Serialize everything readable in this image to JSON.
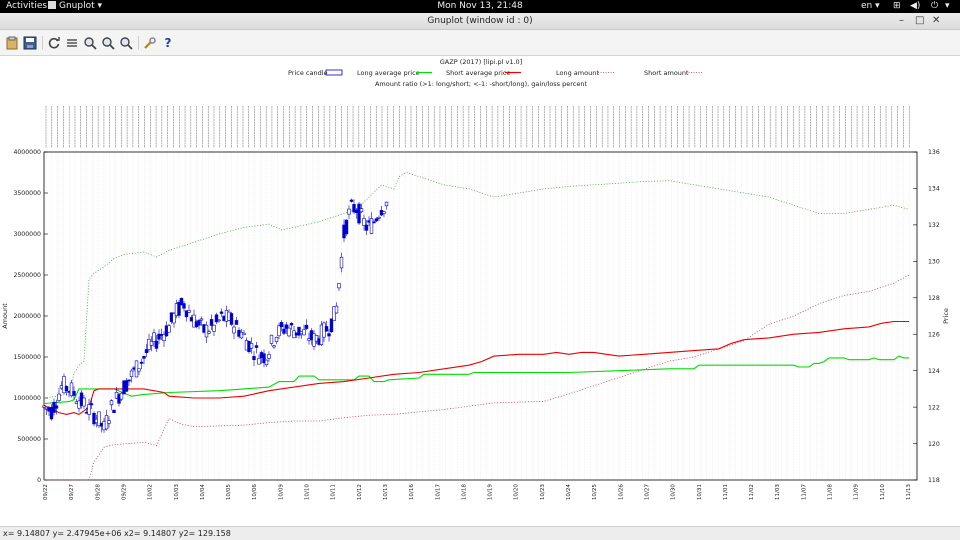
{
  "topbar": {
    "activities": "Activities",
    "app_name": "Gnuplot",
    "clock": "Mon Nov 13, 21:48",
    "language": "en"
  },
  "window": {
    "title": "Gnuplot (window id : 0)"
  },
  "toolbar": {
    "buttons": [
      "copy-to-clipboard",
      "print",
      "replot",
      "toggle-grid",
      "previous-zoom",
      "next-zoom",
      "autoscale",
      "config",
      "help"
    ]
  },
  "statusbar": {
    "text": "x= 9.14807 y= 2.47945e+06 x2= 9.14807 y2= 129.158"
  },
  "chart_data": {
    "type": "candlestick",
    "title": "GAZP (2017)  [lipi.pl v1.0]",
    "subtitle": "Amount ratio (>1: long/short; <-1: -short/long), gain/loss percent",
    "legend": [
      "Price candle",
      "Long average price",
      "Short average price",
      "Long amount",
      "Short amount"
    ],
    "colors": {
      "candle": "#0000cc",
      "long_avg": "#00dd00",
      "short_avg": "#ee0000",
      "long_amount": "#33aa33",
      "short_amount": "#cc3355"
    },
    "y_left_label": "Amount",
    "y_right_label": "Price",
    "y_left_ticks": [
      "0",
      "500000",
      "1000000",
      "1500000",
      "2000000",
      "2500000",
      "3000000",
      "3500000",
      "4000000"
    ],
    "y_left_range": [
      0,
      4000000
    ],
    "y_right_ticks": [
      "118",
      "120",
      "122",
      "124",
      "126",
      "128",
      "130",
      "132",
      "134",
      "136"
    ],
    "y_right_range": [
      118,
      136
    ],
    "date_labels": [
      "09/22",
      "09/27",
      "09/28",
      "09/29",
      "10/02",
      "10/03",
      "10/04",
      "10/05",
      "10/06",
      "10/09",
      "10/10",
      "10/11",
      "10/12",
      "10/13",
      "10/16",
      "10/17",
      "10/18",
      "10/19",
      "10/20",
      "10/23",
      "10/24",
      "10/25",
      "10/26",
      "10/27",
      "10/30",
      "10/31",
      "11/01",
      "11/02",
      "11/03",
      "11/07",
      "11/08",
      "11/09",
      "11/10",
      "11/13"
    ],
    "n_points": 150,
    "long_avg": [
      [
        0,
        122.2
      ],
      [
        10,
        122.3
      ],
      [
        12,
        122.4
      ],
      [
        14,
        123.0
      ],
      [
        28,
        123.0
      ],
      [
        35,
        122.6
      ],
      [
        40,
        122.7
      ],
      [
        50,
        122.8
      ],
      [
        70,
        122.9
      ],
      [
        80,
        123.0
      ],
      [
        90,
        123.1
      ],
      [
        94,
        123.4
      ],
      [
        100,
        123.4
      ],
      [
        102,
        123.7
      ],
      [
        108,
        123.7
      ],
      [
        110,
        123.5
      ],
      [
        124,
        123.5
      ],
      [
        126,
        123.7
      ],
      [
        130,
        123.7
      ],
      [
        132,
        123.4
      ],
      [
        134,
        123.4
      ],
      [
        136,
        123.4
      ],
      [
        138,
        123.5
      ],
      [
        150,
        123.6
      ],
      [
        152,
        123.8
      ],
      [
        170,
        123.8
      ],
      [
        172,
        123.9
      ],
      [
        200,
        123.9
      ],
      [
        210,
        123.9
      ],
      [
        230,
        124.0
      ],
      [
        250,
        124.1
      ],
      [
        260,
        124.1
      ],
      [
        262,
        124.3
      ],
      [
        280,
        124.3
      ],
      [
        300,
        124.3
      ],
      [
        302,
        124.2
      ],
      [
        306,
        124.2
      ],
      [
        308,
        124.4
      ],
      [
        310,
        124.4
      ],
      [
        312,
        124.5
      ],
      [
        314,
        124.7
      ],
      [
        320,
        124.7
      ],
      [
        322,
        124.6
      ],
      [
        330,
        124.6
      ],
      [
        332,
        124.7
      ],
      [
        334,
        124.6
      ],
      [
        340,
        124.6
      ],
      [
        342,
        124.8
      ],
      [
        344,
        124.7
      ],
      [
        346,
        124.7
      ]
    ],
    "short_avg": [
      [
        0,
        122.1
      ],
      [
        3,
        121.9
      ],
      [
        6,
        121.7
      ],
      [
        9,
        121.6
      ],
      [
        12,
        121.7
      ],
      [
        14,
        121.6
      ],
      [
        16,
        121.8
      ],
      [
        18,
        122.0
      ],
      [
        20,
        122.9
      ],
      [
        22,
        123.0
      ],
      [
        26,
        123.0
      ],
      [
        40,
        123.0
      ],
      [
        48,
        122.8
      ],
      [
        50,
        122.6
      ],
      [
        60,
        122.5
      ],
      [
        70,
        122.5
      ],
      [
        80,
        122.6
      ],
      [
        90,
        122.9
      ],
      [
        100,
        123.1
      ],
      [
        110,
        123.3
      ],
      [
        120,
        123.4
      ],
      [
        130,
        123.6
      ],
      [
        140,
        123.8
      ],
      [
        150,
        123.9
      ],
      [
        160,
        124.1
      ],
      [
        170,
        124.3
      ],
      [
        175,
        124.5
      ],
      [
        180,
        124.8
      ],
      [
        190,
        124.9
      ],
      [
        200,
        124.9
      ],
      [
        205,
        125.0
      ],
      [
        210,
        124.9
      ],
      [
        215,
        125.0
      ],
      [
        220,
        125.0
      ],
      [
        225,
        124.9
      ],
      [
        230,
        124.8
      ],
      [
        240,
        124.9
      ],
      [
        250,
        125.0
      ],
      [
        260,
        125.1
      ],
      [
        270,
        125.2
      ],
      [
        275,
        125.5
      ],
      [
        280,
        125.7
      ],
      [
        290,
        125.8
      ],
      [
        300,
        126.0
      ],
      [
        310,
        126.1
      ],
      [
        320,
        126.3
      ],
      [
        330,
        126.4
      ],
      [
        335,
        126.6
      ],
      [
        340,
        126.7
      ],
      [
        346,
        126.7
      ]
    ],
    "long_amount": [
      [
        0,
        1000000
      ],
      [
        5,
        1020000
      ],
      [
        10,
        1050000
      ],
      [
        12,
        1300000
      ],
      [
        14,
        1400000
      ],
      [
        16,
        1450000
      ],
      [
        18,
        2450000
      ],
      [
        20,
        2520000
      ],
      [
        24,
        2600000
      ],
      [
        28,
        2700000
      ],
      [
        32,
        2750000
      ],
      [
        40,
        2780000
      ],
      [
        45,
        2720000
      ],
      [
        50,
        2800000
      ],
      [
        60,
        2900000
      ],
      [
        70,
        3000000
      ],
      [
        80,
        3080000
      ],
      [
        90,
        3120000
      ],
      [
        95,
        3050000
      ],
      [
        100,
        3080000
      ],
      [
        110,
        3150000
      ],
      [
        115,
        3200000
      ],
      [
        120,
        3250000
      ],
      [
        125,
        3300000
      ],
      [
        130,
        3450000
      ],
      [
        135,
        3600000
      ],
      [
        140,
        3550000
      ],
      [
        142,
        3700000
      ],
      [
        145,
        3750000
      ],
      [
        150,
        3700000
      ],
      [
        160,
        3600000
      ],
      [
        170,
        3550000
      ],
      [
        180,
        3450000
      ],
      [
        190,
        3500000
      ],
      [
        200,
        3550000
      ],
      [
        210,
        3580000
      ],
      [
        220,
        3600000
      ],
      [
        230,
        3620000
      ],
      [
        240,
        3640000
      ],
      [
        250,
        3650000
      ],
      [
        260,
        3600000
      ],
      [
        270,
        3550000
      ],
      [
        280,
        3500000
      ],
      [
        290,
        3450000
      ],
      [
        300,
        3350000
      ],
      [
        305,
        3300000
      ],
      [
        310,
        3250000
      ],
      [
        320,
        3250000
      ],
      [
        330,
        3300000
      ],
      [
        340,
        3350000
      ],
      [
        346,
        3300000
      ]
    ],
    "short_amount": [
      [
        0,
        0
      ],
      [
        18,
        0
      ],
      [
        20,
        220000
      ],
      [
        24,
        400000
      ],
      [
        28,
        430000
      ],
      [
        40,
        460000
      ],
      [
        45,
        420000
      ],
      [
        50,
        750000
      ],
      [
        55,
        680000
      ],
      [
        60,
        650000
      ],
      [
        70,
        660000
      ],
      [
        80,
        670000
      ],
      [
        90,
        700000
      ],
      [
        100,
        720000
      ],
      [
        110,
        720000
      ],
      [
        120,
        760000
      ],
      [
        130,
        790000
      ],
      [
        140,
        800000
      ],
      [
        150,
        830000
      ],
      [
        160,
        860000
      ],
      [
        170,
        900000
      ],
      [
        180,
        940000
      ],
      [
        190,
        950000
      ],
      [
        200,
        960000
      ],
      [
        210,
        1050000
      ],
      [
        220,
        1150000
      ],
      [
        230,
        1250000
      ],
      [
        240,
        1350000
      ],
      [
        250,
        1450000
      ],
      [
        260,
        1500000
      ],
      [
        270,
        1600000
      ],
      [
        280,
        1700000
      ],
      [
        290,
        1900000
      ],
      [
        300,
        2000000
      ],
      [
        310,
        2150000
      ],
      [
        320,
        2250000
      ],
      [
        330,
        2300000
      ],
      [
        340,
        2400000
      ],
      [
        346,
        2500000
      ]
    ]
  }
}
